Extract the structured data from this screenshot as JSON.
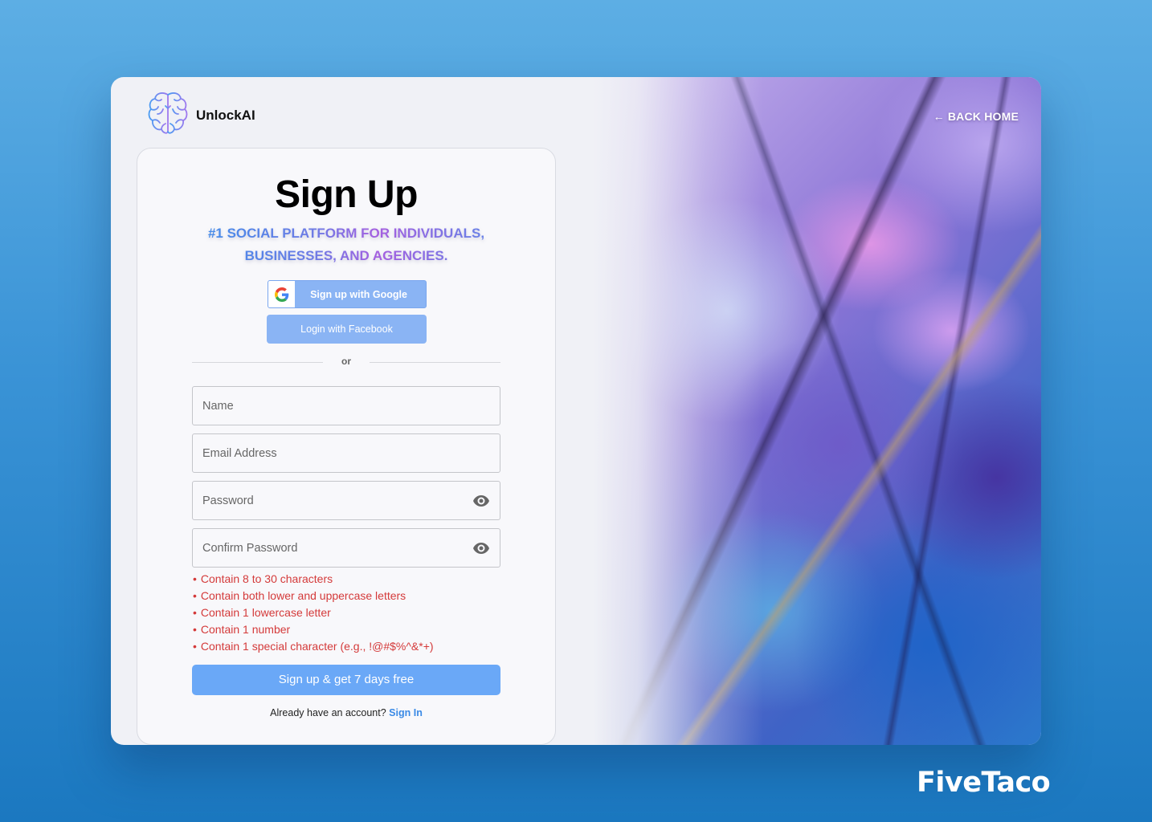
{
  "brand": {
    "name": "UnlockAI",
    "logo_icon": "brain-icon"
  },
  "nav": {
    "back_home": "← BACK HOME"
  },
  "form": {
    "title": "Sign Up",
    "subtitle": "#1 Social Platform for Individuals, Businesses, and Agencies.",
    "google_button": "Sign up with Google",
    "facebook_button": "Login with Facebook",
    "divider": "or",
    "fields": {
      "name": {
        "placeholder": "Name",
        "value": ""
      },
      "email": {
        "placeholder": "Email Address",
        "value": ""
      },
      "password": {
        "placeholder": "Password",
        "value": "",
        "icon": "eye-icon"
      },
      "confirm_password": {
        "placeholder": "Confirm Password",
        "value": "",
        "icon": "eye-icon"
      }
    },
    "password_rules": [
      "Contain 8 to 30 characters",
      "Contain both lower and uppercase letters",
      "Contain 1 lowercase letter",
      "Contain 1 number",
      "Contain 1 special character (e.g., !@#$%^&*+)"
    ],
    "submit_button": "Sign up & get 7 days free",
    "signin_prompt": "Already have an account?",
    "signin_link": "Sign In"
  },
  "colors": {
    "primary_button": "#6aa8f7",
    "social_button": "#8ab4f4",
    "error_text": "#d43a3a",
    "link": "#3a8ae6"
  },
  "watermark": "FiveTaco"
}
